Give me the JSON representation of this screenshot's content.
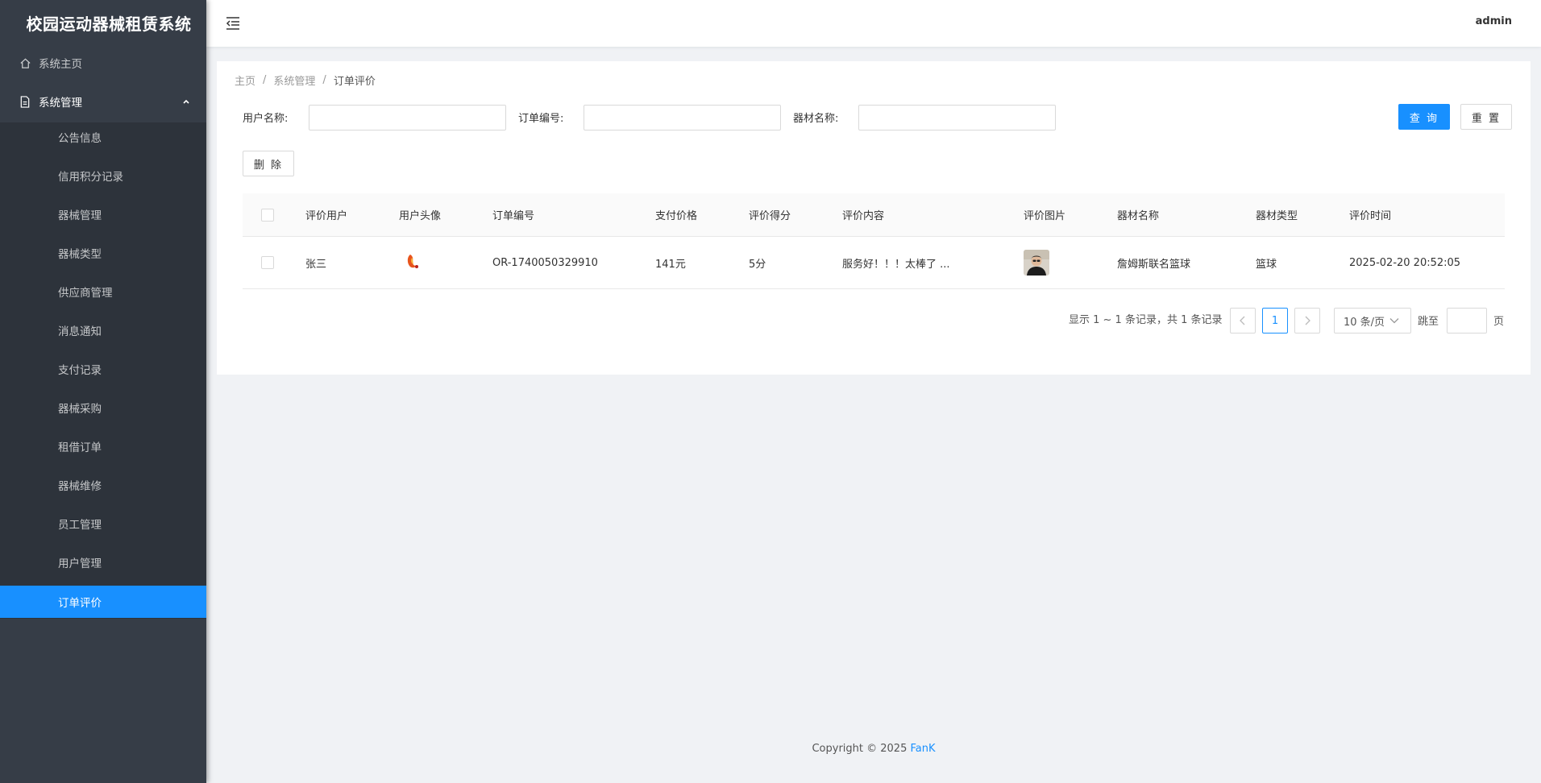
{
  "app": {
    "title": "校园运动器械租赁系统"
  },
  "header": {
    "user": "admin"
  },
  "sidebar": {
    "home": "系统主页",
    "group": "系统管理",
    "items": [
      "公告信息",
      "信用积分记录",
      "器械管理",
      "器械类型",
      "供应商管理",
      "消息通知",
      "支付记录",
      "器械采购",
      "租借订单",
      "器械维修",
      "员工管理",
      "用户管理",
      "订单评价"
    ],
    "active_index": 12
  },
  "breadcrumb": [
    "主页",
    "系统管理",
    "订单评价"
  ],
  "breadcrumb_sep": "/",
  "search": {
    "user_label": "用户名称:",
    "order_label": "订单编号:",
    "equipment_label": "器材名称:",
    "user_value": "",
    "order_value": "",
    "equipment_value": "",
    "query_button": "查 询",
    "reset_button": "重 置"
  },
  "toolbar": {
    "delete_button": "删 除"
  },
  "table": {
    "columns": [
      "评价用户",
      "用户头像",
      "订单编号",
      "支付价格",
      "评价得分",
      "评价内容",
      "评价图片",
      "器材名称",
      "器材类型",
      "评价时间"
    ],
    "rows": [
      {
        "user": "张三",
        "avatar": "avatar-icon",
        "order_no": "OR-1740050329910",
        "price": "141元",
        "score": "5分",
        "content": "服务好！！！太棒了 ...",
        "image": "review-photo",
        "equipment": "詹姆斯联名篮球",
        "type": "篮球",
        "time": "2025-02-20 20:52:05"
      }
    ]
  },
  "pagination": {
    "summary": "显示 1 ~ 1 条记录，共 1 条记录",
    "current_page": "1",
    "page_size": "10 条/页",
    "jump_label": "跳至",
    "jump_value": "",
    "page_suffix": "页"
  },
  "footer": {
    "copyright": "Copyright © 2025 ",
    "brand": "FanK"
  },
  "colors": {
    "accent": "#1890ff",
    "sidebar_bg": "#363d47",
    "submenu_bg": "#2d333b",
    "page_bg": "#f0f2f5"
  }
}
